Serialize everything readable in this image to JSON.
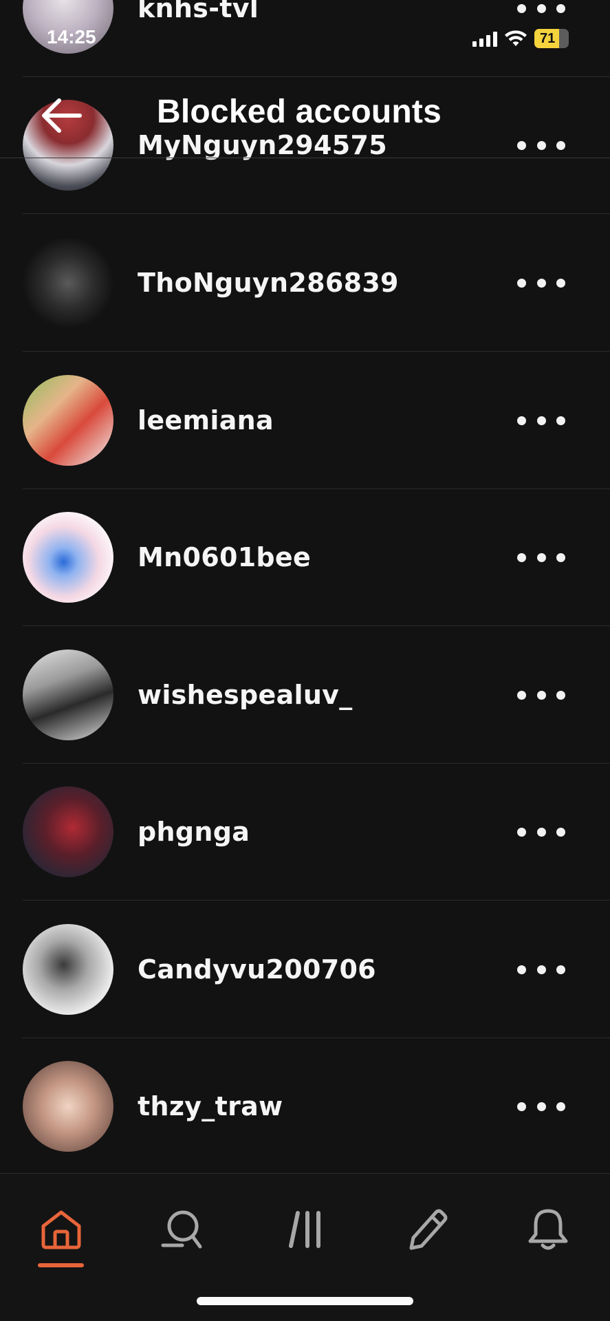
{
  "status_bar": {
    "time": "14:25",
    "battery_percent": "71",
    "battery_level": 0.71
  },
  "header": {
    "title": "Blocked accounts",
    "back_icon": "arrow-left-icon"
  },
  "blocked_accounts": [
    {
      "username": "knhs-tvl"
    },
    {
      "username": "MyNguyn294575"
    },
    {
      "username": "ThoNguyn286839"
    },
    {
      "username": "leemiana"
    },
    {
      "username": "Mn0601bee"
    },
    {
      "username": "wishespealuv_"
    },
    {
      "username": "phgnga"
    },
    {
      "username": "Candyvu200706"
    },
    {
      "username": "thzy_traw"
    }
  ],
  "bottom_nav": {
    "items": [
      {
        "icon": "home-icon",
        "active": true
      },
      {
        "icon": "search-icon",
        "active": false
      },
      {
        "icon": "feeds-icon",
        "active": false
      },
      {
        "icon": "compose-pencil-icon",
        "active": false
      },
      {
        "icon": "bell-icon",
        "active": false
      }
    ],
    "active_color": "#e8653a",
    "inactive_color": "#a8a8a8"
  }
}
